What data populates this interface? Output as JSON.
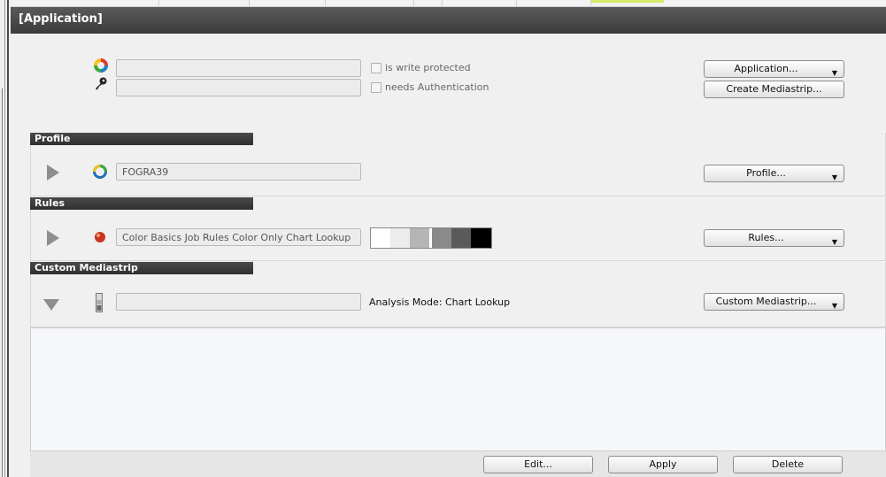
{
  "header": {
    "title": "[Application]"
  },
  "application": {
    "name_value": "",
    "auth_value": "",
    "write_protected_label": "is write protected",
    "write_protected_checked": false,
    "needs_auth_label": "needs Authentication",
    "needs_auth_checked": false,
    "application_button": "Application...",
    "create_mediastrip_button": "Create Mediastrip..."
  },
  "profile": {
    "header": "Profile",
    "value": "FOGRA39",
    "button": "Profile..."
  },
  "rules": {
    "header": "Rules",
    "value": "Color Basics Job Rules Color Only Chart Lookup",
    "button": "Rules...",
    "swatches": [
      "#ffffff",
      "#ececec",
      "#b5b5b5",
      "#8a8a8a",
      "#5a5a5a",
      "#2e2e2e",
      "#000000"
    ]
  },
  "custom_mediastrip": {
    "header": "Custom Mediastrip",
    "value": "",
    "analysis_mode": "Analysis Mode: Chart Lookup",
    "button": "Custom Mediastrip..."
  },
  "footer": {
    "edit_button": "Edit...",
    "apply_button": "Apply",
    "delete_button": "Delete"
  },
  "icons": {
    "application": "color-ring-icon",
    "key": "key-icon",
    "profile": "profile-ring-icon",
    "rules": "color-drop-icon",
    "mediastrip": "mediastrip-icon",
    "dropdown": "chevron-down-icon"
  }
}
